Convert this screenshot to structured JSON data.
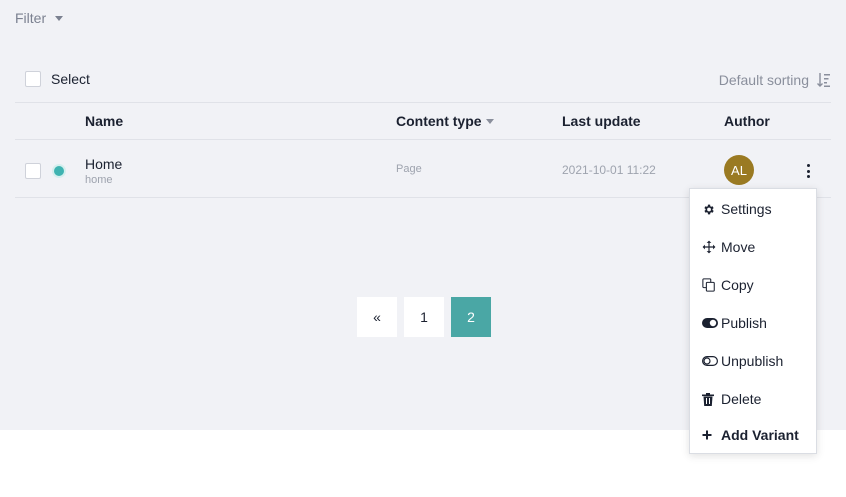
{
  "filter": {
    "label": "Filter"
  },
  "toolbar": {
    "select_label": "Select",
    "sorting_label": "Default sorting"
  },
  "table": {
    "columns": {
      "name": "Name",
      "content_type": "Content type",
      "last_update": "Last update",
      "author": "Author"
    },
    "rows": [
      {
        "name": "Home",
        "slug": "home",
        "content_type": "Page",
        "last_update": "2021-10-01 11:22",
        "author_initials": "AL",
        "status_color": "#3fb3b1"
      }
    ]
  },
  "pagination": {
    "prev": "«",
    "pages": [
      "1",
      "2"
    ],
    "current": "2"
  },
  "context_menu": {
    "items": [
      {
        "label": "Settings",
        "icon": "gear-icon"
      },
      {
        "label": "Move",
        "icon": "move-icon"
      },
      {
        "label": "Copy",
        "icon": "copy-icon"
      },
      {
        "label": "Publish",
        "icon": "toggle-on-icon"
      },
      {
        "label": "Unpublish",
        "icon": "toggle-off-icon"
      },
      {
        "label": "Delete",
        "icon": "trash-icon"
      },
      {
        "label": "Add Variant",
        "icon": "plus-icon"
      }
    ]
  },
  "colors": {
    "accent": "#4aa7a5",
    "background": "#f1f2f6",
    "avatar": "#9a7a22"
  }
}
